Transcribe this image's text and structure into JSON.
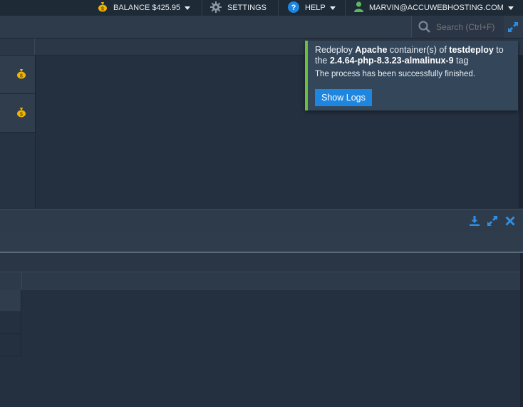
{
  "topbar": {
    "balance_label": "BALANCE $425.95",
    "settings_label": "SETTINGS",
    "help_label": "HELP",
    "user_label": "MARVIN@ACCUWEBHOSTING.COM"
  },
  "search": {
    "placeholder": "Search (Ctrl+F)"
  },
  "notification": {
    "prefix": "Redeploy ",
    "component": "Apache",
    "middle": " container(s) of ",
    "environment": "testdeploy",
    "tail": " to the ",
    "tag": "2.4.64-php-8.3.23-almalinux-9",
    "suffix": " tag",
    "message": "The process has been successfully finished.",
    "button_label": "Show Logs"
  },
  "colors": {
    "accent_button": "#1f86e0",
    "success_bar": "#6cbf3a",
    "coin_icon": "#f0b400",
    "user_icon": "#5cb85c",
    "help_icon": "#1f86e0"
  },
  "icons": [
    "money-bag-icon",
    "gear-icon",
    "help-icon",
    "user-icon",
    "search-icon",
    "expand-icon",
    "download-icon",
    "close-icon"
  ]
}
